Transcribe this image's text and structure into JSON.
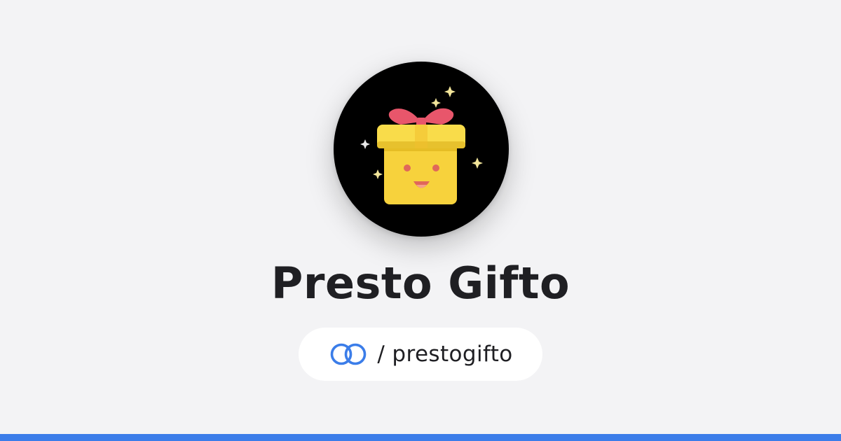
{
  "profile": {
    "display_name": "Presto Gifto",
    "handle": "/ prestogifto",
    "avatar_icon": "smiling-gift-box-icon",
    "logo_icon": "linked-rings-logo-icon"
  },
  "colors": {
    "background": "#f3f3f5",
    "avatar_background": "#000000",
    "gift_box": "#f7d23c",
    "ribbon": "#e8566b",
    "sparkle": "#f2e59a",
    "logo_blue": "#3b7de9",
    "bottom_bar": "#3b7de9",
    "text": "#1f1f23"
  }
}
